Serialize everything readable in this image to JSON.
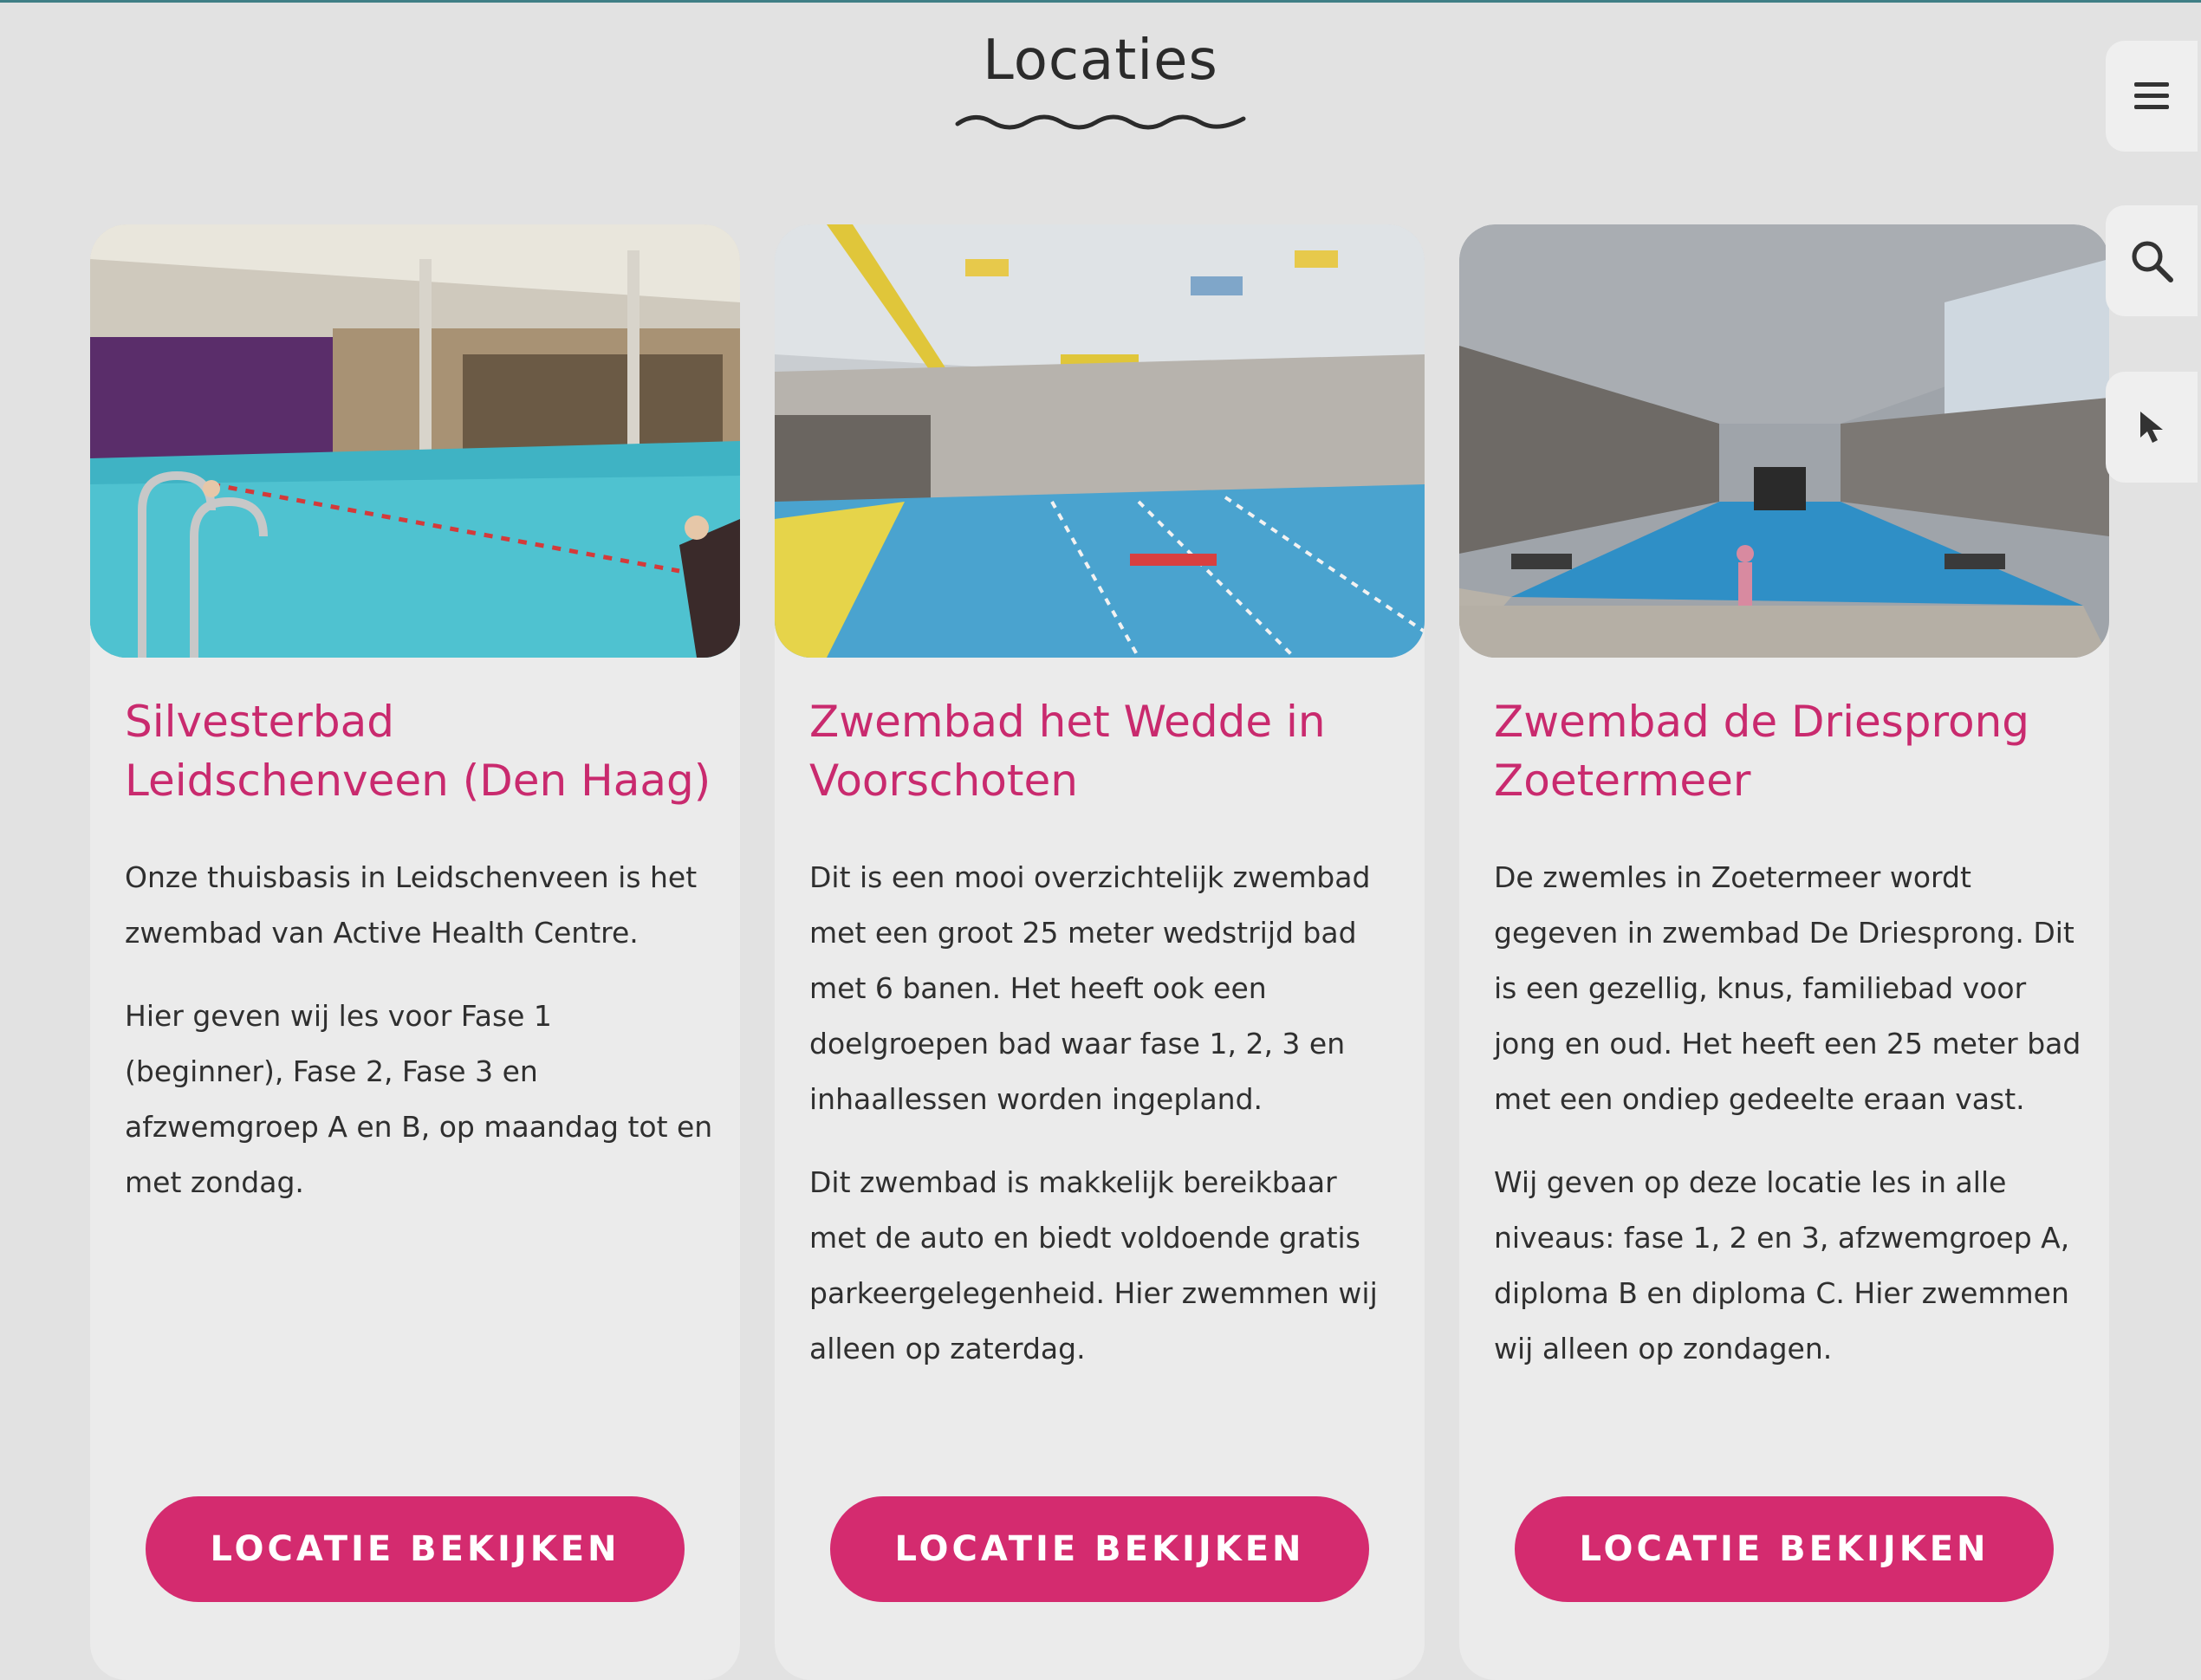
{
  "section": {
    "title": "Locaties"
  },
  "sidebar_tools": [
    {
      "icon": "hamburger-menu-icon"
    },
    {
      "icon": "search-icon"
    },
    {
      "icon": "cursor-icon"
    }
  ],
  "colors": {
    "accent": "#d42b6f",
    "title_pink": "#c92a6e",
    "background": "#e2e2e2",
    "card": "#ebebeb"
  },
  "locations": [
    {
      "title": "Silvesterbad Leidschenveen (Den Haag)",
      "paragraphs": [
        "Onze thuisbasis in Leidschenveen is het zwembad van Active Health Centre.",
        "Hier geven wij les voor Fase 1 (beginner), Fase 2, Fase 3 en afzwemgroep A en B, op maandag tot en met zondag."
      ],
      "button": "LOCATIE BEKIJKEN"
    },
    {
      "title": "Zwembad het Wedde in Voorschoten",
      "paragraphs": [
        "Dit is een mooi overzichtelijk zwembad met een groot 25 meter wedstrijd bad met 6 banen. Het heeft ook een doelgroepen bad waar fase 1, 2, 3 en inhaallessen worden ingepland.",
        "Dit zwembad is makkelijk bereikbaar met de auto en biedt voldoende gratis parkeergelegenheid. Hier zwemmen wij alleen op zaterdag."
      ],
      "button": "LOCATIE BEKIJKEN"
    },
    {
      "title": "Zwembad de Driesprong Zoetermeer",
      "paragraphs": [
        "De zwemles in Zoetermeer wordt gegeven in zwembad De Driesprong. Dit is een gezellig, knus, familiebad voor jong en oud. Het heeft een 25 meter bad met een ondiep gedeelte eraan vast.",
        "Wij geven op deze locatie les in alle niveaus: fase 1, 2 en 3, afzwemgroep A, diploma B en diploma C. Hier zwemmen wij alleen op zondagen."
      ],
      "button": "LOCATIE BEKIJKEN"
    }
  ]
}
